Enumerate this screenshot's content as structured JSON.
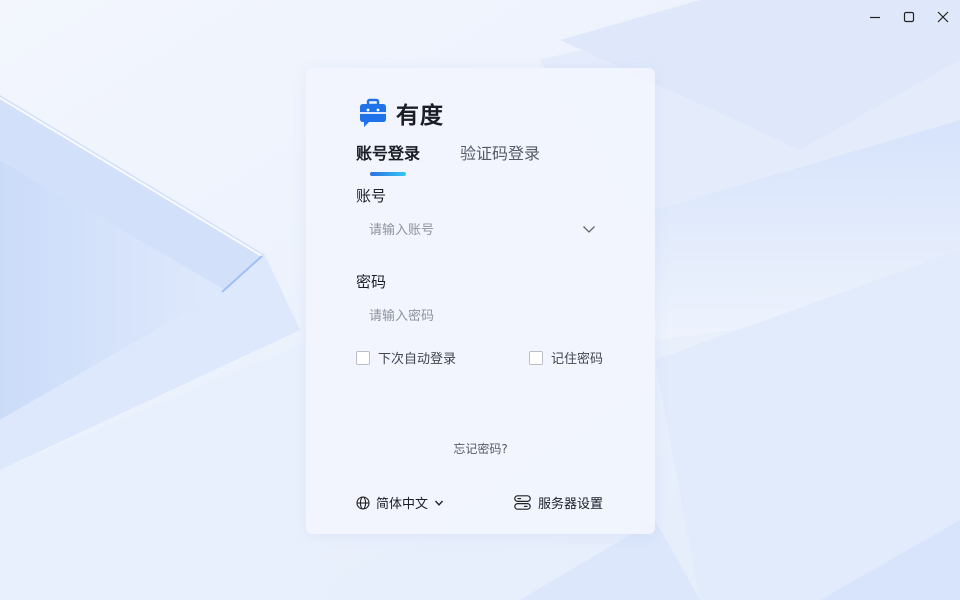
{
  "app": {
    "name": "有度",
    "accent_color": "#1f72e8"
  },
  "window_controls": {
    "minimize_icon": "minimize-icon",
    "maximize_icon": "maximize-icon",
    "close_icon": "close-icon"
  },
  "login": {
    "tabs": [
      {
        "label": "账号登录",
        "active": true
      },
      {
        "label": "验证码登录",
        "active": false
      }
    ],
    "account": {
      "label": "账号",
      "placeholder": "请输入账号",
      "value": ""
    },
    "password": {
      "label": "密码",
      "placeholder": "请输入密码",
      "value": ""
    },
    "auto_login": {
      "label": "下次自动登录",
      "checked": false
    },
    "remember_password": {
      "label": "记住密码",
      "checked": false
    },
    "forgot_password": "忘记密码?",
    "language": {
      "selected": "简体中文",
      "icon": "globe-icon"
    },
    "server_settings": {
      "label": "服务器设置",
      "icon": "server-icon"
    }
  }
}
